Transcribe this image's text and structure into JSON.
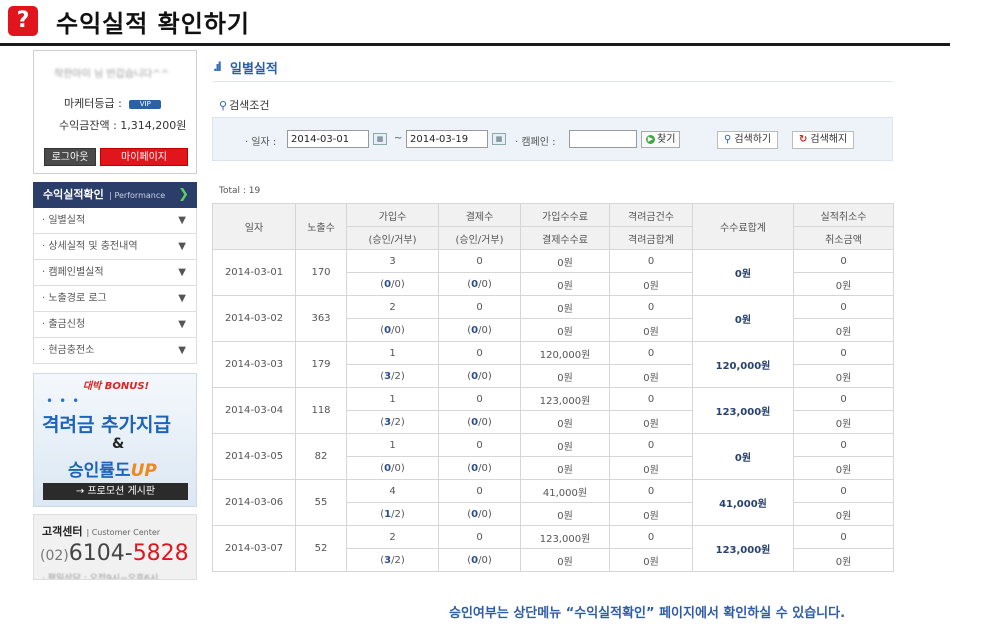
{
  "header": {
    "icon_glyph": "?",
    "title": "수익실적 확인하기"
  },
  "sidebar": {
    "greeting_blurred": "착한아이 님 반갑습니다^^",
    "grade_label": "마케터등급 :",
    "grade_badge": "VIP",
    "balance": "수익금잔액 : 1,314,200원",
    "logout_label": "로그아웃",
    "mypage_label": "마이페이지",
    "menu_title": "수익실적확인",
    "menu_subtitle": "| Performance",
    "menu_items": [
      {
        "label": "· 일별실적"
      },
      {
        "label": "· 상세실적 및 충전내역"
      },
      {
        "label": "· 캠페인별실적"
      },
      {
        "label": "· 노출경로 로그"
      },
      {
        "label": "· 출금신청"
      },
      {
        "label": "· 현금충전소"
      }
    ],
    "banner": {
      "top": "대박 BONUS!",
      "line1": "격려금 추가지급",
      "amp": "&",
      "line2_a": "승인률도",
      "line2_b": "UP",
      "button": "→ 프로모션 게시판"
    },
    "customer_center": {
      "title": "고객센터",
      "subtitle": "| Customer Center",
      "phone_prefix": "(02)",
      "phone_main": "6104-",
      "phone_red": "5828",
      "footer_blurred": "· 평일상담 : 오전9시~오후6시"
    }
  },
  "main": {
    "section_title": "일별실적",
    "search_label": "검색조건",
    "date_label": "· 일자 :",
    "date_from": "2014-03-01",
    "tilde": "~",
    "date_to": "2014-03-19",
    "campaign_label": "· 캠페인 :",
    "campaign_value": "",
    "find_label": "찾기",
    "search_button": "검색하기",
    "reset_button": "검색해지",
    "total": "Total : 19",
    "headers": {
      "date": "일자",
      "exposure": "노출수",
      "join": "가입수",
      "pay": "결제수",
      "join_fee": "가입수수료",
      "bonus_count": "격려금건수",
      "fee_total": "수수료합계",
      "cancel": "실적취소수",
      "join_sub": "(승인/거부)",
      "pay_sub": "(승인/거부)",
      "pay_fee": "결제수수료",
      "bonus_total": "격려금합계",
      "cancel_amount": "취소금액"
    },
    "rows": [
      {
        "date": "2014-03-01",
        "exposure": "170",
        "join": "3",
        "pay": "0",
        "join_fee": "0원",
        "bonus_count": "0",
        "fee_total": "0원",
        "cancel": "0",
        "join_ok": "0",
        "join_rej": "/0)",
        "pay_ok": "0",
        "pay_rej": "/0)",
        "pay_fee": "0원",
        "bonus_total": "0원",
        "cancel_amount": "0원"
      },
      {
        "date": "2014-03-02",
        "exposure": "363",
        "join": "2",
        "pay": "0",
        "join_fee": "0원",
        "bonus_count": "0",
        "fee_total": "0원",
        "cancel": "0",
        "join_ok": "0",
        "join_rej": "/0)",
        "pay_ok": "0",
        "pay_rej": "/0)",
        "pay_fee": "0원",
        "bonus_total": "0원",
        "cancel_amount": "0원"
      },
      {
        "date": "2014-03-03",
        "exposure": "179",
        "join": "1",
        "pay": "0",
        "join_fee": "120,000원",
        "bonus_count": "0",
        "fee_total": "120,000원",
        "cancel": "0",
        "join_ok": "3",
        "join_rej": "/2)",
        "pay_ok": "0",
        "pay_rej": "/0)",
        "pay_fee": "0원",
        "bonus_total": "0원",
        "cancel_amount": "0원"
      },
      {
        "date": "2014-03-04",
        "exposure": "118",
        "join": "1",
        "pay": "0",
        "join_fee": "123,000원",
        "bonus_count": "0",
        "fee_total": "123,000원",
        "cancel": "0",
        "join_ok": "3",
        "join_rej": "/2)",
        "pay_ok": "0",
        "pay_rej": "/0)",
        "pay_fee": "0원",
        "bonus_total": "0원",
        "cancel_amount": "0원"
      },
      {
        "date": "2014-03-05",
        "exposure": "82",
        "join": "1",
        "pay": "0",
        "join_fee": "0원",
        "bonus_count": "0",
        "fee_total": "0원",
        "cancel": "0",
        "join_ok": "0",
        "join_rej": "/0)",
        "pay_ok": "0",
        "pay_rej": "/0)",
        "pay_fee": "0원",
        "bonus_total": "0원",
        "cancel_amount": "0원"
      },
      {
        "date": "2014-03-06",
        "exposure": "55",
        "join": "4",
        "pay": "0",
        "join_fee": "41,000원",
        "bonus_count": "0",
        "fee_total": "41,000원",
        "cancel": "0",
        "join_ok": "1",
        "join_rej": "/2)",
        "pay_ok": "0",
        "pay_rej": "/0)",
        "pay_fee": "0원",
        "bonus_total": "0원",
        "cancel_amount": "0원"
      },
      {
        "date": "2014-03-07",
        "exposure": "52",
        "join": "2",
        "pay": "0",
        "join_fee": "123,000원",
        "bonus_count": "0",
        "fee_total": "123,000원",
        "cancel": "0",
        "join_ok": "3",
        "join_rej": "/2)",
        "pay_ok": "0",
        "pay_rej": "/0)",
        "pay_fee": "0원",
        "bonus_total": "0원",
        "cancel_amount": "0원"
      }
    ]
  },
  "footer_note": "승인여부는 상단메뉴 “수익실적확인” 페이지에서 확인하실 수 있습니다."
}
